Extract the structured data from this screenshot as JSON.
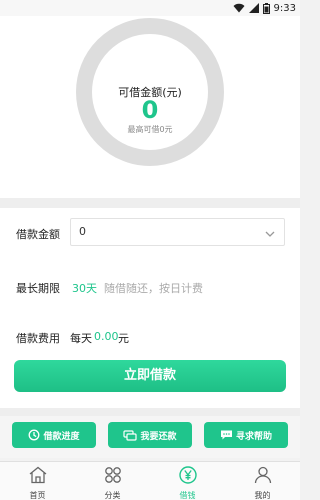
{
  "status_bar": {
    "time": "9:33"
  },
  "hero": {
    "title": "可借金额(元)",
    "amount": "0",
    "subtitle": "最高可借0元"
  },
  "form": {
    "amount_label": "借款金额",
    "amount_value": "0",
    "term_label": "最长期限",
    "term_value": "30天",
    "term_hint": "随借随还，按日计费",
    "fee_label": "借款费用",
    "fee_prefix": "每天",
    "fee_value": "0.00",
    "fee_unit": "元",
    "submit_label": "立即借款"
  },
  "actions": [
    {
      "label": "借款进度",
      "icon": "progress-icon"
    },
    {
      "label": "我要还款",
      "icon": "repay-icon"
    },
    {
      "label": "寻求帮助",
      "icon": "help-icon"
    }
  ],
  "bottom_nav": {
    "items": [
      {
        "label": "首页",
        "icon": "home-icon"
      },
      {
        "label": "分类",
        "icon": "category-icon"
      },
      {
        "label": "借钱",
        "icon": "yen-icon",
        "active": true
      },
      {
        "label": "我的",
        "icon": "user-icon"
      }
    ]
  },
  "colors": {
    "accent": "#1fc58c",
    "ring": "#dddddd"
  }
}
